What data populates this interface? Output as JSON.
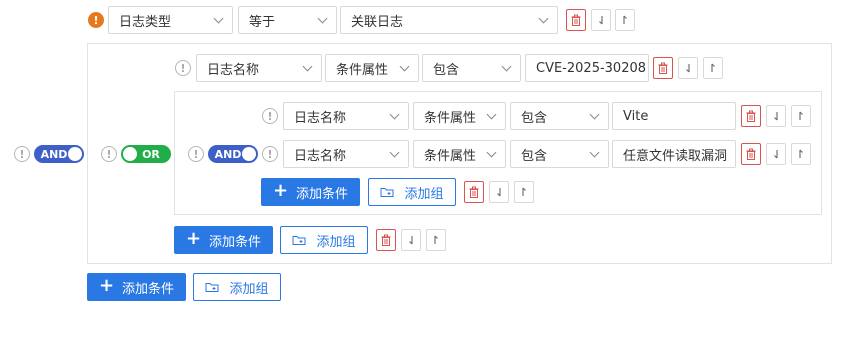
{
  "colors": {
    "primary": "#2a78e4",
    "and_toggle": "#3d5fc7",
    "or_toggle": "#21ad4a",
    "delete": "#d9534f",
    "warning": "#e6781f"
  },
  "labels": {
    "and": "AND",
    "or": "OR",
    "add_condition": "添加条件",
    "add_group": "添加组"
  },
  "icons": {
    "warning": "!",
    "info": "!"
  },
  "top_row": {
    "field": "日志类型",
    "operator": "等于",
    "value": "关联日志"
  },
  "group1_row": {
    "field": "日志名称",
    "attribute": "条件属性",
    "operator": "包含",
    "value": "CVE-2025-30208"
  },
  "group2_rows": [
    {
      "field": "日志名称",
      "attribute": "条件属性",
      "operator": "包含",
      "value": "Vite"
    },
    {
      "field": "日志名称",
      "attribute": "条件属性",
      "operator": "包含",
      "value": "任意文件读取漏洞"
    }
  ]
}
